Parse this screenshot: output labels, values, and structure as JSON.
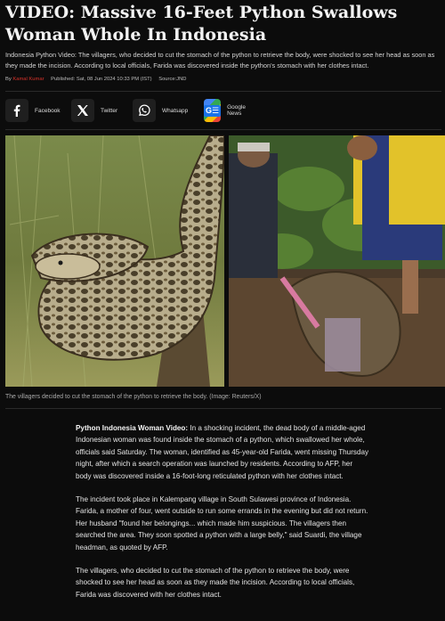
{
  "article": {
    "headline": "VIDEO: Massive 16-Feet Python Swallows Woman Whole In Indonesia",
    "summary": "Indonesia Python Video: The villagers, who decided to cut the stomach of the python to retrieve the body, were shocked to see her head as soon as they made the incision. According to local officials, Farida was discovered inside the python's stomach with her clothes intact.",
    "byline": {
      "prefix": "By",
      "author": "Kamal Kumar",
      "published": "Published: Sat, 08 Jun 2024 10:33 PM (IST)",
      "source": "Source:JND"
    }
  },
  "share": {
    "facebook": "Facebook",
    "twitter": "Twitter",
    "whatsapp": "Whatsapp",
    "google_news": "Google News",
    "google_news_badge": "G☰"
  },
  "image": {
    "caption": "The villagers decided to cut the stomach of the python to retrieve the body. (Image: Reuters/X)"
  },
  "body": {
    "p1_lead": "Python Indonesia Woman Video:",
    "p1": "In a shocking incident, the dead body of a middle-aged Indonesian woman was found inside the stomach of a python, which swallowed her whole, officials said Saturday. The woman, identified as 45-year-old Farida, went missing Thursday night, after which a search operation was launched by residents. According to AFP, her body was discovered inside a 16-foot-long reticulated python with her clothes intact.",
    "p2": "The incident took place in Kalempang village in South Sulawesi province of Indonesia. Farida, a mother of four, went outside to run some errands in the evening but did not return. Her husband \"found her belongings... which made him suspicious. The villagers then searched the area. They soon spotted a python with a large belly,\" said Suardi, the village headman, as quoted by AFP.",
    "p3": "The villagers, who decided to cut the stomach of the python to retrieve the body, were shocked to see her head as soon as they made the incision. According to local officials, Farida was discovered with her clothes intact."
  },
  "colors": {
    "background": "#0c0c0c",
    "author": "#d8322a",
    "text": "#e6e6e6"
  }
}
